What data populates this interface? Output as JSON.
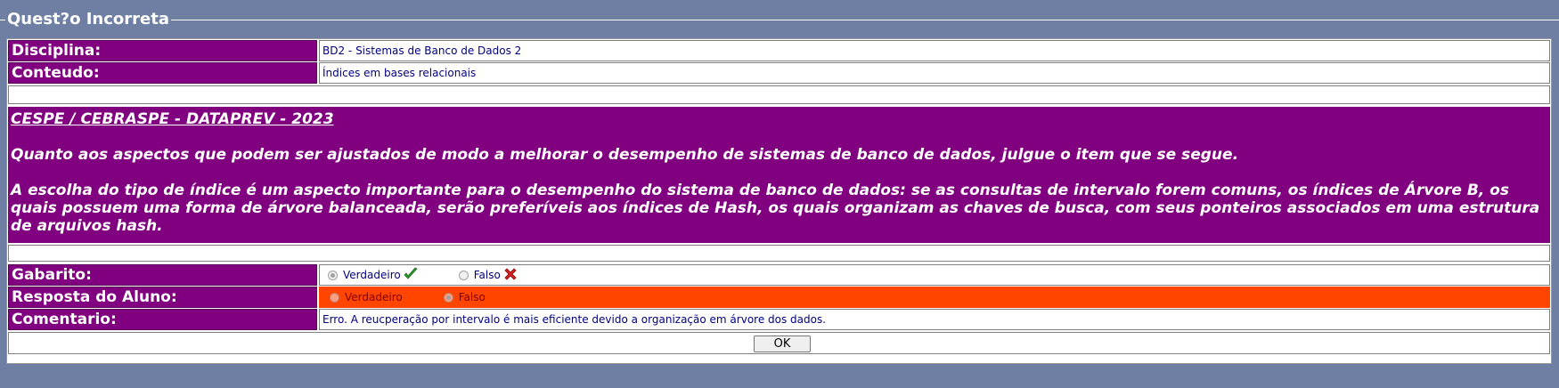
{
  "legend": {
    "title": "Quest?o Incorreta"
  },
  "rows": {
    "disciplina": {
      "label": "Disciplina:",
      "value": "BD2 - Sistemas de Banco de Dados 2"
    },
    "conteudo": {
      "label": "Conteudo:",
      "value": "Índices em bases relacionais"
    }
  },
  "question": {
    "source": "CESPE / CEBRASPE - DATAPREV - 2023",
    "prompt": "Quanto aos aspectos que podem ser ajustados de modo a melhorar o desempenho de sistemas de banco de dados, julgue o item que se segue.",
    "statement": "A escolha do tipo de índice é um aspecto importante para o desempenho do sistema de banco de dados: se as consultas de intervalo forem comuns, os índices de Árvore B, os quais possuem uma forma de árvore balanceada, serão preferíveis aos índices de Hash, os quais organizam as chaves de busca, com seus ponteiros associados em uma estrutura de arquivos hash."
  },
  "gabarito": {
    "label": "Gabarito:",
    "options": [
      "Verdadeiro",
      "Falso"
    ],
    "selected": "Verdadeiro",
    "icons": [
      "check-icon",
      "cross-icon"
    ]
  },
  "resposta": {
    "label": "Resposta do Aluno:",
    "options": [
      "Verdadeiro",
      "Falso"
    ],
    "selected": "Falso"
  },
  "comentario": {
    "label": "Comentario:",
    "value": "Erro. A reucperação por intervalo é mais eficiente devido a organização em árvore dos dados."
  },
  "actions": {
    "ok_label": "OK"
  },
  "colors": {
    "background": "#6f7fa3",
    "label_bg": "#800080",
    "wrong_answer_bg": "#ff4500",
    "value_text": "#000080"
  }
}
